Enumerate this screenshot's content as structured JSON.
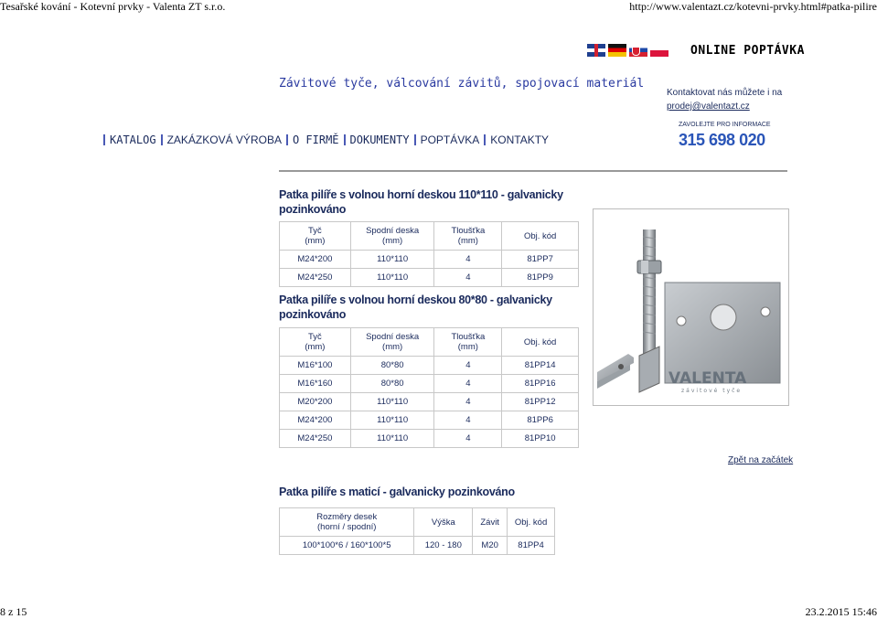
{
  "print_header": {
    "doc_title": "Tesařské kování - Kotevní prvky - Valenta ZT s.r.o.",
    "url": "http://www.valentazt.cz/kotevni-prvky.html#patka-pilire"
  },
  "print_footer": {
    "page": "8 z 15",
    "datetime": "23.2.2015 15:46"
  },
  "header": {
    "online_label": "ONLINE POPTÁVKA",
    "tagline": "Závitové tyče, válcování závitů, spojovací materiál",
    "contact_line1": "Kontaktovat nás můžete i na",
    "contact_email": "prodej@valentazt.cz",
    "call_label": "ZAVOLEJTE PRO INFORMACE",
    "phone": "315 698 020"
  },
  "nav": {
    "items": [
      "KATALOG",
      "ZAKÁZKOVÁ VÝROBA",
      "O FIRMĚ",
      "DOKUMENTY",
      "POPTÁVKA",
      "KONTAKTY"
    ]
  },
  "section1": {
    "title_line1": "Patka pilíře s volnou horní deskou 110*110 - galvanicky",
    "title_line2": "pozinkováno",
    "headers": [
      [
        "Tyč",
        "(mm)"
      ],
      [
        "Spodní deska",
        "(mm)"
      ],
      [
        "Tloušťka",
        "(mm)"
      ],
      [
        "Obj. kód",
        ""
      ]
    ],
    "rows": [
      [
        "M24*200",
        "110*110",
        "4",
        "81PP7"
      ],
      [
        "M24*250",
        "110*110",
        "4",
        "81PP9"
      ]
    ]
  },
  "section2": {
    "title_line1": "Patka pilíře s volnou horní deskou 80*80 - galvanicky",
    "title_line2": "pozinkováno",
    "headers": [
      [
        "Tyč",
        "(mm)"
      ],
      [
        "Spodní deska",
        "(mm)"
      ],
      [
        "Tloušťka",
        "(mm)"
      ],
      [
        "Obj. kód",
        ""
      ]
    ],
    "rows": [
      [
        "M16*100",
        "80*80",
        "4",
        "81PP14"
      ],
      [
        "M16*160",
        "80*80",
        "4",
        "81PP16"
      ],
      [
        "M20*200",
        "110*110",
        "4",
        "81PP12"
      ],
      [
        "M24*200",
        "110*110",
        "4",
        "81PP6"
      ],
      [
        "M24*250",
        "110*110",
        "4",
        "81PP10"
      ]
    ]
  },
  "product_image": {
    "watermark": "VALENTA",
    "watermark_sub": "závitové tyče"
  },
  "back_link": "Zpět na začátek",
  "section3": {
    "title": "Patka pilíře s maticí - galvanicky pozinkováno",
    "headers": [
      [
        "Rozměry desek",
        "(horní / spodní)"
      ],
      [
        "Výška",
        ""
      ],
      [
        "Závit",
        ""
      ],
      [
        "Obj. kód",
        ""
      ]
    ],
    "rows": [
      [
        "100*100*6 / 160*100*5",
        "120 - 180",
        "M20",
        "81PP4"
      ]
    ]
  }
}
